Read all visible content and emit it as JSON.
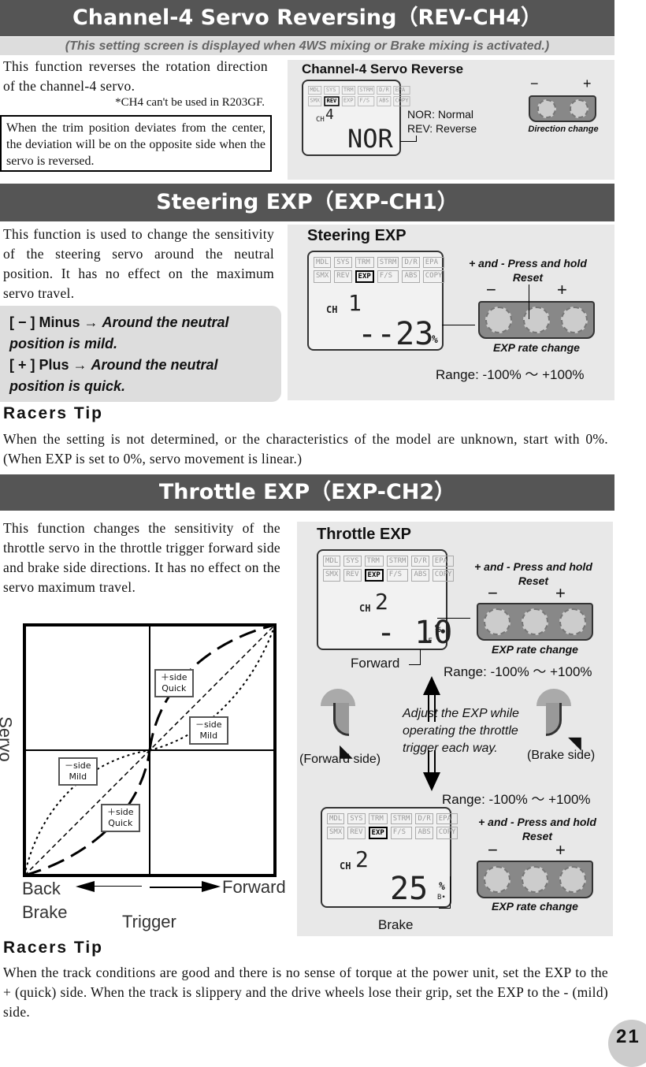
{
  "section1": {
    "title": "Channel-4 Servo Reversing（REV-CH4）",
    "subtitle": "(This setting screen is displayed when 4WS mixing or Brake mixing is activated.)",
    "body": "This function reverses the rotation direction of the channel-4 servo.",
    "note": "*CH4 can't be used in R203GF.",
    "box": "When the trim position deviates from the center, the deviation will be on the opposite side when the servo is reversed.",
    "panel": {
      "title": "Channel-4 Servo Reverse",
      "ch_label": "CH",
      "ch": "4",
      "value": "NOR",
      "legend1": "NOR: Normal",
      "legend2": "REV: Reverse",
      "minus": "−",
      "plus": "+",
      "button_caption": "Direction change"
    }
  },
  "menu": [
    "MDL",
    "SYS",
    "TRM",
    "STRM",
    "D/R",
    "EPA",
    "SMX",
    "REV",
    "EXP",
    "F/S",
    "ABS",
    "COPY"
  ],
  "section2": {
    "title": "Steering EXP（EXP-CH1）",
    "body": "This function is used to change the sensitivity of the steering servo around the neutral position. It has no effect on the maximum servo travel.",
    "minus_key": "[ − ] Minus",
    "minus_arrow": "→",
    "minus_desc": "Around the neutral position is mild.",
    "plus_key": "[ + ] Plus",
    "plus_arrow": "→",
    "plus_desc": "Around the neutral position is quick.",
    "panel": {
      "title": "Steering EXP",
      "ch_label": "CH",
      "ch": "1",
      "value": "--23",
      "unit": "%",
      "hold": "+ and - Press and hold",
      "reset": "Reset",
      "minus": "−",
      "plus": "+",
      "caption": "EXP rate change",
      "range": "Range: -100% ～ +100%"
    }
  },
  "tip1": {
    "title": "Racers Tip",
    "text": "When the setting is not determined, or the characteristics of the model are unknown, start with 0%. (When EXP is set to 0%, servo movement is linear.)"
  },
  "section3": {
    "title": "Throttle EXP（EXP-CH2）",
    "body": "This function changes the sensitivity of the throttle servo in the throttle trigger forward side and brake side directions. It has no effect on the servo maximum travel.",
    "graph": {
      "y_label": "Servo",
      "x_left": "Back\nBrake",
      "x_right": "Forward",
      "x_label": "Trigger",
      "box1": [
        "＋side",
        "Quick"
      ],
      "box2": [
        "－side",
        "Mild"
      ],
      "box3": [
        "－side",
        "Mild"
      ],
      "box4": [
        "＋side",
        "Quick"
      ]
    },
    "panel": {
      "title": "Throttle EXP",
      "fwd": {
        "ch_label": "CH",
        "ch": "2",
        "value": "- 10",
        "unit": "%",
        "suffix": "•F",
        "label": "Forward"
      },
      "brk": {
        "ch_label": "CH",
        "ch": "2",
        "value": "25",
        "unit": "%",
        "suffix": "B•",
        "label": "Brake"
      },
      "hold": "+ and - Press and hold",
      "reset": "Reset",
      "minus": "−",
      "plus": "+",
      "caption": "EXP rate change",
      "range": "Range: -100% ～ +100%",
      "forward_side": "(Forward side)",
      "brake_side": "(Brake side)",
      "adjust": "Adjust the EXP while operating the throttle trigger each way."
    }
  },
  "tip2": {
    "title": "Racers Tip",
    "text": "When the track conditions are good and there is no sense of torque at the power unit, set the EXP to the + (quick) side. When the track is slippery and the drive wheels lose their grip, set the EXP to the - (mild) side."
  },
  "page_number": "21"
}
